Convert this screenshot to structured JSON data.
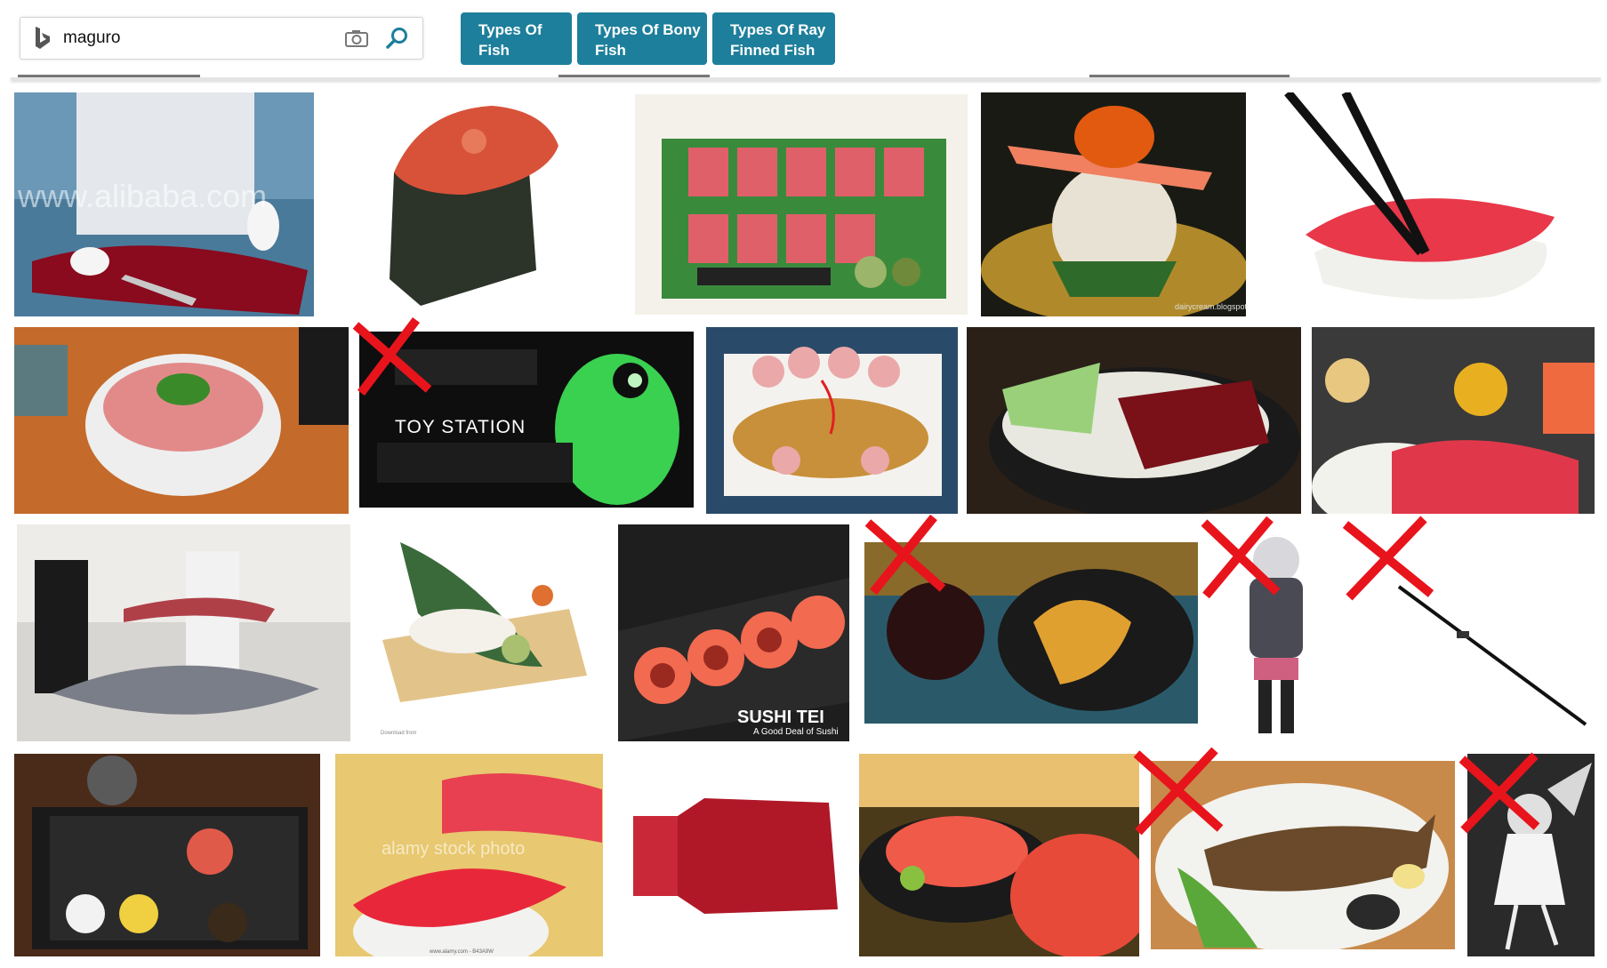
{
  "search": {
    "query": "maguro"
  },
  "chips": [
    {
      "label": "Types Of\nFish"
    },
    {
      "label": "Types Of Bony\nFish"
    },
    {
      "label": "Types Of Ray\nFinned Fish"
    }
  ],
  "image_captions": {
    "watermark_alibaba": "www.alibaba.com",
    "dairycream": "dairycream.blogspot",
    "toy_station_title": "TOY STATION",
    "sushi_tei_brand": "SUSHI TEI",
    "sushi_tei_tag": "A Good Deal of Sushi",
    "alamy_watermark": "alamy stock photo",
    "alamy_id": "www.alamy.com - B43A9W",
    "dreamstime_download": "Download from",
    "dreamstime_site": "Dreamstime.com"
  },
  "rejected_marks": [
    "toy-station",
    "soy-tempura",
    "anime-girl",
    "fishing-rod",
    "grilled-fish",
    "anime-angel"
  ]
}
